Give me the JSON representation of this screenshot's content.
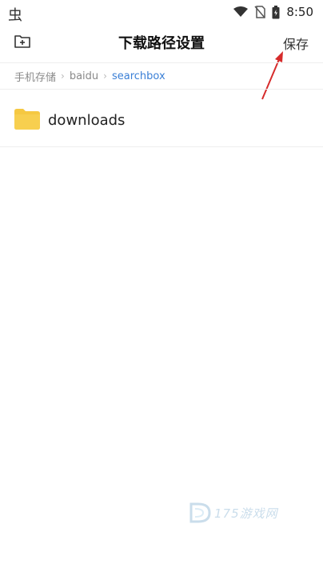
{
  "status_bar": {
    "app_glyph": "虫",
    "time": "8:50",
    "icons": [
      "wifi-icon",
      "no-sim-icon",
      "battery-icon"
    ]
  },
  "header": {
    "new_folder_icon": "folder-plus-icon",
    "title": "下载路径设置",
    "save_label": "保存"
  },
  "breadcrumb": {
    "items": [
      "手机存储",
      "baidu",
      "searchbox"
    ],
    "active_index": 2
  },
  "folders": [
    {
      "name": "downloads",
      "icon": "folder-icon"
    }
  ],
  "colors": {
    "accent": "#3a7fd6",
    "folder": "#f5c842",
    "annotation_arrow": "#d62b2b",
    "watermark": "#6aa0c8"
  },
  "watermark": {
    "text": "175游戏网"
  }
}
